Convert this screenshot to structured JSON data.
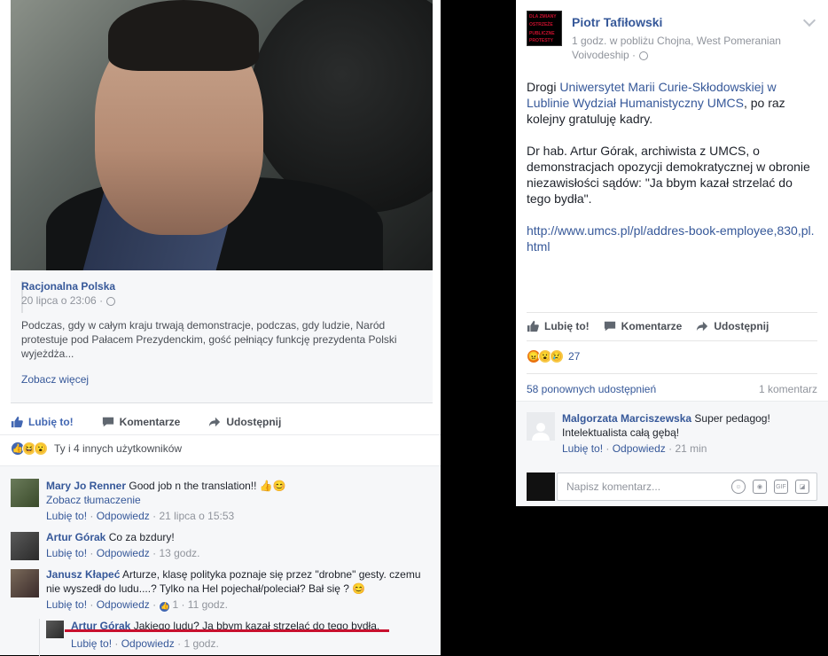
{
  "left_post": {
    "link_card": {
      "source_name": "Racjonalna Polska",
      "date": "20 lipca o 23:06 ·",
      "description": "Podczas, gdy w całym kraju trwają demonstracje, podczas, gdy ludzie, Naród protestuje pod Pałacem Prezydenckim, gość pełniący funkcję prezydenta Polski wyjeżdża...",
      "see_more": "Zobacz więcej"
    },
    "actions": {
      "like": "Lubię to!",
      "comment": "Komentarze",
      "share": "Udostępnij"
    },
    "reactions_summary": "Ty i 4 innych użytkowników",
    "comments": [
      {
        "author": "Mary Jo Renner",
        "text": "Good job n the translation!! 👍😊",
        "translate": "Zobacz tłumaczenie",
        "like": "Lubię to!",
        "reply": "Odpowiedz",
        "time": "21 lipca o 15:53"
      },
      {
        "author": "Artur Górak",
        "text": "Co za bzdury!",
        "like": "Lubię to!",
        "reply": "Odpowiedz",
        "time": "13 godz."
      },
      {
        "author": "Janusz Kłapeć",
        "text": "Arturze, klasę polityka poznaje się przez \"drobne\" gesty. czemu nie wyszedł do ludu....? Tylko na Hel pojechał/poleciał? Bał się ? 😊",
        "like": "Lubię to!",
        "reply": "Odpowiedz",
        "likes_count": "1",
        "time": "11 godz."
      },
      {
        "author": "Artur Górak",
        "text": "Jakiego ludu? Ja bbym kazał strzelać do tego bydła.",
        "like": "Lubię to!",
        "reply": "Odpowiedz",
        "time": "1 godz."
      }
    ]
  },
  "right_post": {
    "author": "Piotr Tafiłowski",
    "meta": "1 godz. w pobliżu Chojna, West Pomeranian Voivodeship ·",
    "avatar_text": [
      "DLA ZMIANY",
      "OSTRZEŻE",
      "PUBLICZNE",
      "PROTESTY"
    ],
    "text_intro": "Drogi ",
    "text_link": "Uniwersytet Marii Curie-Skłodowskiej w Lublinie Wydział Humanistyczny UMCS",
    "text_after_link": ", po raz kolejny gratuluję kadry.",
    "paragraph2": "Dr hab. Artur Górak, archiwista z UMCS, o demonstracjach opozycji demokratycznej w obronie niezawisłości sądów: \"Ja bbym kazał strzelać do tego bydła\".",
    "url": "http://www.umcs.pl/pl/addres-book-employee,830,pl.html",
    "actions": {
      "like": "Lubię to!",
      "comment": "Komentarze",
      "share": "Udostępnij"
    },
    "reactions_count": "27",
    "shares": "58 ponownych udostępnień",
    "comments_count": "1 komentarz",
    "comment": {
      "author": "Malgorzata Marciszewska",
      "text": "Super pedagog! Intelektualista całą gębą!",
      "like": "Lubię to!",
      "reply": "Odpowiedz",
      "time": "21 min"
    },
    "comment_placeholder": "Napisz komentarz..."
  }
}
